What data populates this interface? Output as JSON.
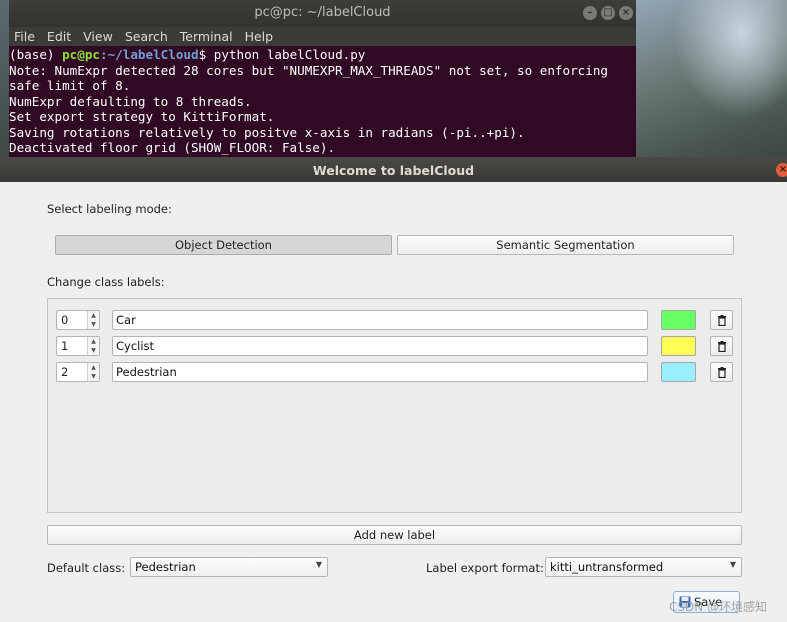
{
  "terminal": {
    "title": "pc@pc: ~/labelCloud",
    "menu": [
      "File",
      "Edit",
      "View",
      "Search",
      "Terminal",
      "Help"
    ],
    "controls": {
      "minimize": "–",
      "maximize": "□",
      "close": "×"
    },
    "prompt": {
      "env": "(base) ",
      "user_host": "pc@pc",
      "path": ":~/labelCloud",
      "symbol": "$ ",
      "command": "python labelCloud.py"
    },
    "lines": [
      "Note: NumExpr detected 28 cores but \"NUMEXPR_MAX_THREADS\" not set, so enforcing",
      "safe limit of 8.",
      "NumExpr defaulting to 8 threads.",
      "Set export strategy to KittiFormat.",
      "Saving rotations relatively to positve x-axis in radians (-pi..+pi).",
      "Deactivated floor grid (SHOW_FLOOR: False)."
    ]
  },
  "dialog": {
    "title": "Welcome to labelCloud",
    "close": "×",
    "mode_label": "Select labeling mode:",
    "modes": {
      "object_detection": "Object Detection",
      "semantic_segmentation": "Semantic Segmentation"
    },
    "active_mode": "Object Detection",
    "class_labels_title": "Change class labels:",
    "classes": [
      {
        "id": "0",
        "name": "Car",
        "color": "#66ff66"
      },
      {
        "id": "1",
        "name": "Cyclist",
        "color": "#ffff55"
      },
      {
        "id": "2",
        "name": "Pedestrian",
        "color": "#99eeff"
      }
    ],
    "add_label": "Add new label",
    "default_class_label": "Default class:",
    "default_class_value": "Pedestrian",
    "export_format_label": "Label export format:",
    "export_format_value": "kitti_untransformed",
    "save_label": "Save",
    "watermark": "CSDN @环境感知"
  }
}
